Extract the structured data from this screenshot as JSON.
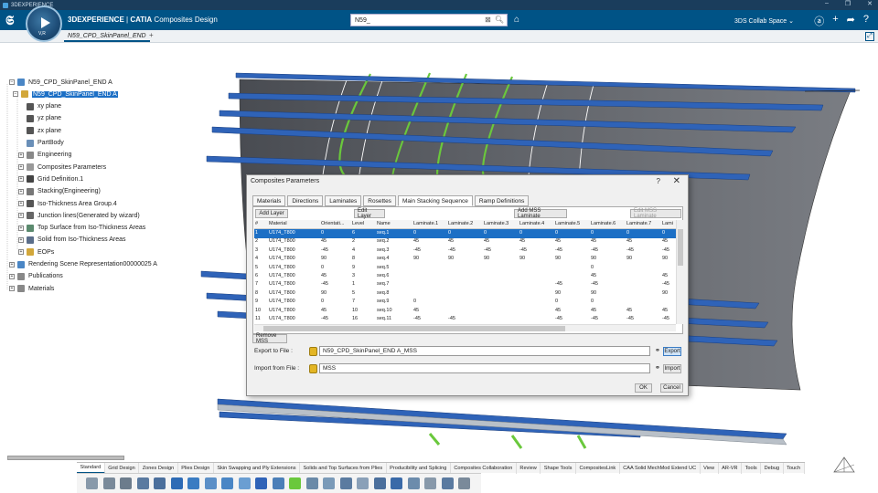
{
  "os_bar": {
    "title": "3DEXPERIENCE"
  },
  "header": {
    "brand_prefix": "3DEXPERIENCE",
    "brand_app": "CATIA",
    "app_name": "Composites Design",
    "compass_label": "V,R",
    "search_value": "N59_",
    "collab_space": "3DS Collab Space"
  },
  "doc_tab": {
    "label": "N59_CPD_SkinPanel_END"
  },
  "tree": {
    "items": [
      {
        "label": "N59_CPD_SkinPanel_END A",
        "level": 0,
        "icon_color": "#4a86c5",
        "selected": false,
        "expander": "−"
      },
      {
        "label": "N59_CPD_SkinPanel_END A",
        "level": 1,
        "icon_color": "#d2a73a",
        "selected": true,
        "expander": "−"
      },
      {
        "label": "xy plane",
        "level": 2,
        "icon_color": "#555555",
        "selected": false,
        "expander": ""
      },
      {
        "label": "yz plane",
        "level": 2,
        "icon_color": "#555555",
        "selected": false,
        "expander": ""
      },
      {
        "label": "zx plane",
        "level": 2,
        "icon_color": "#555555",
        "selected": false,
        "expander": ""
      },
      {
        "label": "PartBody",
        "level": 2,
        "icon_color": "#6a8fb8",
        "selected": false,
        "expander": ""
      },
      {
        "label": "Engineering",
        "level": 2,
        "icon_color": "#888888",
        "selected": false,
        "expander": "+"
      },
      {
        "label": "Composites Parameters",
        "level": 2,
        "icon_color": "#999999",
        "selected": false,
        "expander": "+"
      },
      {
        "label": "Grid Definition.1",
        "level": 2,
        "icon_color": "#444444",
        "selected": false,
        "expander": "+"
      },
      {
        "label": "Stacking(Engineering)",
        "level": 2,
        "icon_color": "#777777",
        "selected": false,
        "expander": "+"
      },
      {
        "label": "Iso-Thickness Area Group.4",
        "level": 2,
        "icon_color": "#555555",
        "selected": false,
        "expander": "+"
      },
      {
        "label": "Junction lines(Generated by wizard)",
        "level": 2,
        "icon_color": "#666666",
        "selected": false,
        "expander": "+"
      },
      {
        "label": "Top Surface from Iso-Thickness Areas",
        "level": 2,
        "icon_color": "#5b8a6e",
        "selected": false,
        "expander": "+"
      },
      {
        "label": "Solid from Iso-Thickness Areas",
        "level": 2,
        "icon_color": "#5b6e8a",
        "selected": false,
        "expander": "+"
      },
      {
        "label": "EOPs",
        "level": 2,
        "icon_color": "#d2a73a",
        "selected": false,
        "expander": "+"
      },
      {
        "label": "Rendering Scene Representation00000025 A",
        "level": 0,
        "icon_color": "#4a86c5",
        "selected": false,
        "expander": "+"
      },
      {
        "label": "Publications",
        "level": 0,
        "icon_color": "#888888",
        "selected": false,
        "expander": "+"
      },
      {
        "label": "Materials",
        "level": 0,
        "icon_color": "#888888",
        "selected": false,
        "expander": "+"
      }
    ]
  },
  "dialog": {
    "title": "Composites Parameters",
    "help": "?",
    "close": "✕",
    "tabs": [
      "Materials",
      "Directions",
      "Laminates",
      "Rosettes",
      "Main Stacking Sequence",
      "Ramp Definitions"
    ],
    "active_tab": "Main Stacking Sequence",
    "buttons": {
      "add_layer": "Add Layer",
      "edit_layer": "Edit Layer",
      "add_mss_laminate": "Add MSS Laminate",
      "edit_mss_laminate": "Edit MSS Laminate",
      "remove_mss": "Remove MSS",
      "export": "Export",
      "import": "Import",
      "ok": "OK",
      "cancel": "Cancel"
    },
    "columns": [
      "#",
      "Material",
      "Orientati...",
      "Level",
      "Name",
      "Laminate.1",
      "Laminate.2",
      "Laminate.3",
      "Laminate.4",
      "Laminate.5",
      "Laminate.6",
      "Laminate.7",
      "Lami"
    ],
    "rows": [
      [
        "1",
        "U174_T800",
        "0",
        "6",
        "seq.1",
        "0",
        "0",
        "0",
        "0",
        "0",
        "0",
        "0",
        "0"
      ],
      [
        "2",
        "U174_T800",
        "45",
        "2",
        "seq.2",
        "45",
        "45",
        "45",
        "45",
        "45",
        "45",
        "45",
        "45"
      ],
      [
        "3",
        "U174_T800",
        "-45",
        "4",
        "seq.3",
        "-45",
        "-45",
        "-45",
        "-45",
        "-45",
        "-45",
        "-45",
        "-45"
      ],
      [
        "4",
        "U174_T800",
        "90",
        "8",
        "seq.4",
        "90",
        "90",
        "90",
        "90",
        "90",
        "90",
        "90",
        "90"
      ],
      [
        "5",
        "U174_T800",
        "0",
        "9",
        "seq.5",
        "",
        "",
        "",
        "",
        "",
        "0",
        "",
        ""
      ],
      [
        "6",
        "U174_T800",
        "45",
        "3",
        "seq.6",
        "",
        "",
        "",
        "",
        "",
        "45",
        "",
        "45"
      ],
      [
        "7",
        "U174_T800",
        "-45",
        "1",
        "seq.7",
        "",
        "",
        "",
        "",
        "-45",
        "-45",
        "",
        "-45"
      ],
      [
        "8",
        "U174_T800",
        "90",
        "5",
        "seq.8",
        "",
        "",
        "",
        "",
        "90",
        "90",
        "",
        "90"
      ],
      [
        "9",
        "U174_T800",
        "0",
        "7",
        "seq.9",
        "0",
        "",
        "",
        "",
        "0",
        "0",
        "",
        ""
      ],
      [
        "10",
        "U174_T800",
        "45",
        "10",
        "seq.10",
        "45",
        "",
        "",
        "",
        "45",
        "45",
        "45",
        "45"
      ],
      [
        "11",
        "U174_T800",
        "-45",
        "16",
        "seq.11",
        "-45",
        "-45",
        "",
        "",
        "-45",
        "-45",
        "-45",
        "-45"
      ]
    ],
    "selected_row": 0,
    "export_label": "Export to File :",
    "export_value": "N59_CPD_SkinPanel_END A_MSS",
    "import_label": "Import from File :",
    "import_value": "MSS"
  },
  "bottom_tabs": [
    "Standard",
    "Grid Design",
    "Zones Design",
    "Plies Design",
    "Skin Swapping and Ply Extensions",
    "Solids and Top Surfaces from Plies",
    "Producibility and Splicing",
    "Composites Collaboration",
    "Review",
    "Shape Tools",
    "CompositesLink",
    "CAA Solid MechMod Extend UC",
    "View",
    "AR-VR",
    "Tools",
    "Debug",
    "Touch"
  ],
  "active_bottom_tab": "Standard",
  "colors": {
    "header_blue": "#005386",
    "selection_blue": "#1c6fc5",
    "surface_gray": "#5a5d63",
    "stringer_blue": "#2f63b8",
    "ply_green": "#6ac83c"
  }
}
